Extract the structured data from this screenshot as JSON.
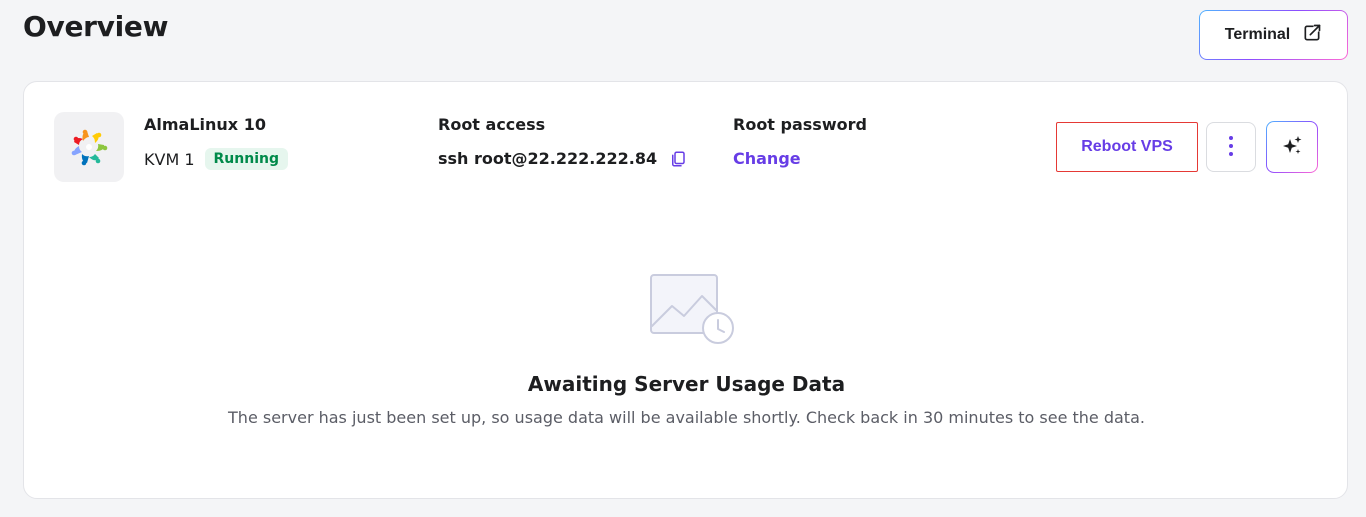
{
  "header": {
    "title": "Overview",
    "terminal_label": "Terminal",
    "terminal_icon": "external-link-icon"
  },
  "server": {
    "os_name": "AlmaLinux 10",
    "os_logo_icon": "almalinux-logo",
    "plan": "KVM 1",
    "status": "Running",
    "root_access_label": "Root access",
    "ssh_command": "ssh root@22.222.222.84",
    "root_password_label": "Root password",
    "change_label": "Change"
  },
  "actions": {
    "reboot_label": "Reboot VPS",
    "more_icon": "vertical-dots-icon",
    "ai_icon": "sparkle-icon"
  },
  "empty_state": {
    "title": "Awaiting Server Usage Data",
    "description": "The server has just been set up, so usage data will be available shortly. Check back in 30 minutes to see the data."
  },
  "colors": {
    "accent": "#673de6",
    "status_bg": "#e6f6ee",
    "status_text": "#008a4a",
    "highlight_border": "#e53935"
  }
}
